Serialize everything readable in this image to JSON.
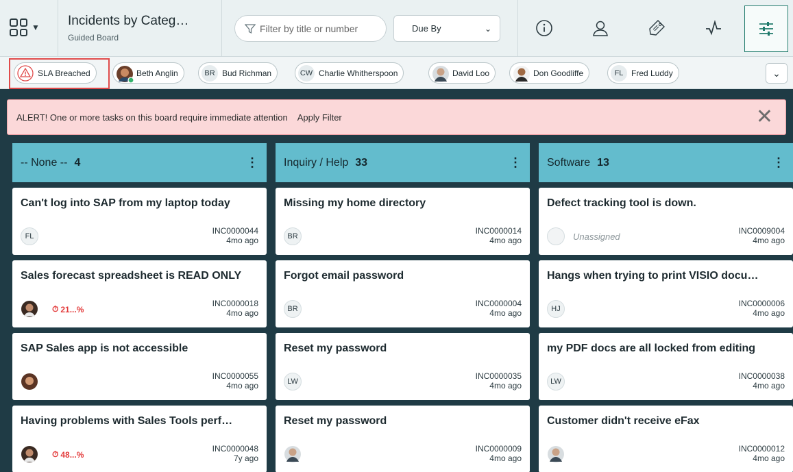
{
  "header": {
    "title": "Incidents by Categ…",
    "subtitle": "Guided Board",
    "filter_placeholder": "Filter by title or number",
    "sort_selected": "Due By",
    "icons": [
      "info-icon",
      "user-icon",
      "tag-icon",
      "activity-icon",
      "filter-settings-icon"
    ]
  },
  "chips": {
    "sla": "SLA Breached",
    "beth": "Beth Anglin",
    "bud_ini": "BR",
    "bud": "Bud Richman",
    "charlie_ini": "CW",
    "charlie": "Charlie Whitherspoon",
    "david": "David Loo",
    "don": "Don Goodliffe",
    "fred_ini": "FL",
    "fred": "Fred Luddy"
  },
  "alert": {
    "message": "ALERT! One or more tasks on this board require immediate attention",
    "action": "Apply Filter"
  },
  "lanes": [
    {
      "name": "-- None --",
      "count": "4",
      "cards": [
        {
          "title": "Can't log into SAP from my laptop today",
          "initials": "FL",
          "number": "INC0000044",
          "age": "4mo ago"
        },
        {
          "title": "Sales forecast spreadsheet is READ ONLY",
          "sla": "21...%",
          "number": "INC0000018",
          "age": "4mo ago"
        },
        {
          "title": "SAP Sales app is not accessible",
          "number": "INC0000055",
          "age": "4mo ago"
        },
        {
          "title": "Having problems with Sales Tools perf…",
          "sla": "48...%",
          "number": "INC0000048",
          "age": "7y ago"
        }
      ]
    },
    {
      "name": "Inquiry / Help",
      "count": "33",
      "cards": [
        {
          "title": "Missing my home directory",
          "initials": "BR",
          "number": "INC0000014",
          "age": "4mo ago"
        },
        {
          "title": "Forgot email password",
          "initials": "BR",
          "number": "INC0000004",
          "age": "4mo ago"
        },
        {
          "title": "Reset my password",
          "initials": "LW",
          "number": "INC0000035",
          "age": "4mo ago"
        },
        {
          "title": "Reset my password",
          "number": "INC0000009",
          "age": "4mo ago"
        }
      ]
    },
    {
      "name": "Software",
      "count": "13",
      "cards": [
        {
          "title": "Defect tracking tool is down.",
          "assignee": "Unassigned",
          "number": "INC0009004",
          "age": "4mo ago"
        },
        {
          "title": "Hangs when trying to print VISIO docu…",
          "initials": "HJ",
          "number": "INC0000006",
          "age": "4mo ago"
        },
        {
          "title": "my PDF docs are all locked from editing",
          "initials": "LW",
          "number": "INC0000038",
          "age": "4mo ago"
        },
        {
          "title": "Customer didn't receive eFax",
          "number": "INC0000012",
          "age": "4mo ago"
        }
      ]
    }
  ]
}
